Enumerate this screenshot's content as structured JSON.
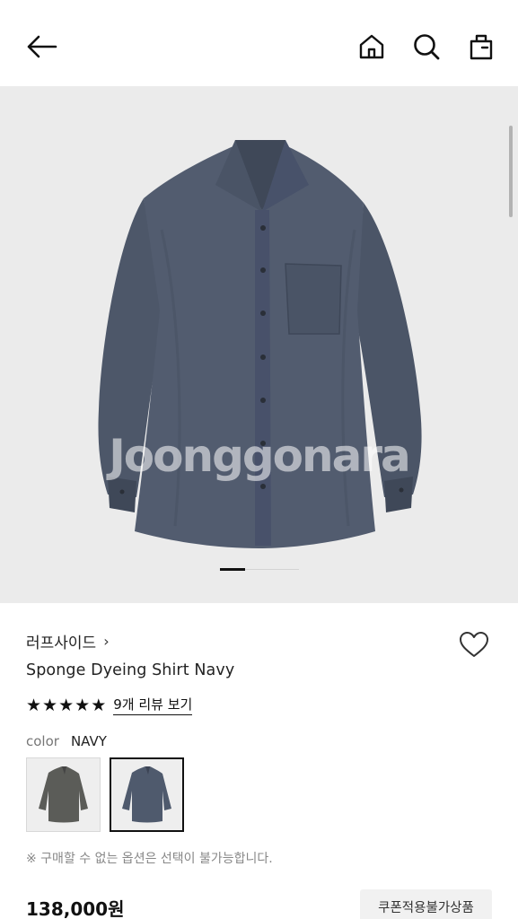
{
  "header": {
    "back_icon": "arrow-left-icon",
    "home_icon": "home-icon",
    "search_icon": "search-icon",
    "bag_icon": "shopping-bag-icon"
  },
  "gallery": {
    "watermark": "Joonggonara",
    "image_count": 2,
    "current_image": 1
  },
  "product": {
    "brand": "러프사이드",
    "brand_chevron": "›",
    "name": "Sponge Dyeing Shirt Navy",
    "rating_stars": 5,
    "review_link": "9개 리뷰 보기",
    "color_label": "color",
    "color_value": "NAVY",
    "option_notice": "※ 구매할 수 없는 옵션은 선택이 불가능합니다.",
    "price": "138,000원",
    "coupon_badge": "쿠폰적용불가상품"
  },
  "colors": {
    "shirt_main": "#525c6f",
    "shirt_dark": "#3f4858",
    "swatch_gray": "#5b5c58",
    "swatch_navy": "#4f5a6d",
    "background": "#ebebeb"
  }
}
